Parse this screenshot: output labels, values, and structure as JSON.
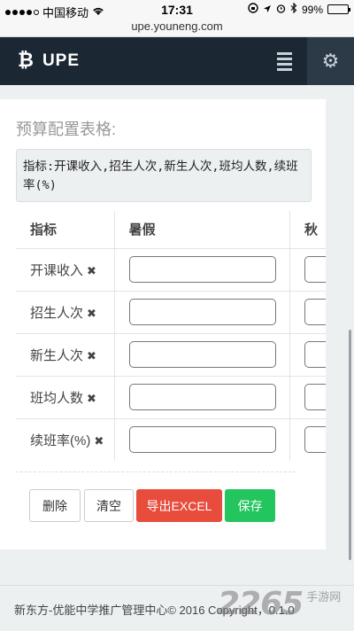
{
  "status_bar": {
    "carrier": "中国移动",
    "time": "17:31",
    "battery": "99%",
    "battery_level": 0.99
  },
  "url_bar": {
    "url": "upe.youneng.com"
  },
  "navbar": {
    "brand": "UPE",
    "logo_glyph": "₿",
    "menu_icon": "bars-icon",
    "settings_glyph": "⚙"
  },
  "panel": {
    "title": "预算配置表格:",
    "info": "指标:开课收入,招生人次,新生人次,班均人数,续班率(%)"
  },
  "table": {
    "headers": [
      "指标",
      "暑假",
      "秋"
    ],
    "remove_glyph": "✖",
    "rows": [
      {
        "label": "开课收入"
      },
      {
        "label": "招生人次"
      },
      {
        "label": "新生人次"
      },
      {
        "label": "班均人数"
      },
      {
        "label": "续班率(%)"
      }
    ]
  },
  "buttons": {
    "delete": "删除",
    "clear": "清空",
    "export": "导出EXCEL",
    "save": "保存"
  },
  "footer": {
    "text": "新东方-优能中学推广管理中心© 2016 Copyright，0.1.0"
  },
  "watermark": {
    "number": "2265",
    "text": "手游网"
  },
  "colors": {
    "navbar": "#1b2733",
    "danger": "#e74c3c",
    "success": "#22c55e"
  }
}
